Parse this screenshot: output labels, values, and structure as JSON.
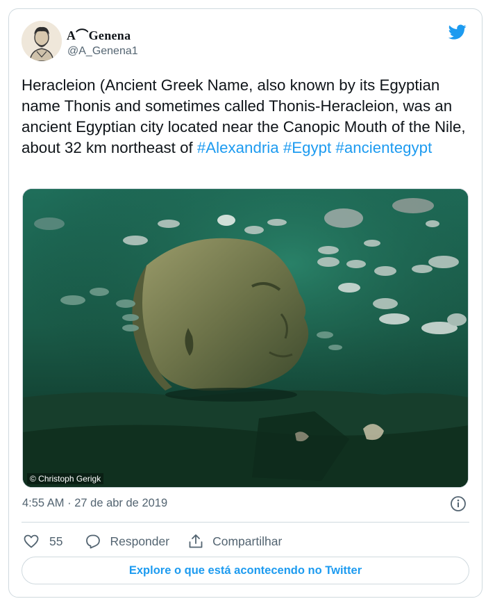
{
  "author": {
    "display_name": "A⌒Genena",
    "handle": "@A_Genena1",
    "avatar": "avatar-illustration"
  },
  "tweet": {
    "text": "Heracleion (Ancient Greek Name, also known by its Egyptian name Thonis and sometimes called Thonis-Heracleion, was an ancient Egyptian city located near the Canopic Mouth of the Nile, about 32 km northeast of",
    "hashtags": "#Alexandria #Egypt #ancientegypt",
    "media_credit": "© Christoph Gerigk",
    "timestamp": "4:55 AM · 27 de abr de 2019"
  },
  "actions": {
    "like_count": "55",
    "reply_label": "Responder",
    "share_label": "Compartilhar"
  },
  "explore_label": "Explore o que está acontecendo no Twitter",
  "icons": [
    "twitter-bird-icon",
    "info-icon",
    "heart-icon",
    "reply-icon",
    "share-icon"
  ],
  "colors": {
    "accent": "#1d9bf0",
    "text": "#0f1419",
    "secondary": "#536471",
    "border": "#cfd9de"
  }
}
